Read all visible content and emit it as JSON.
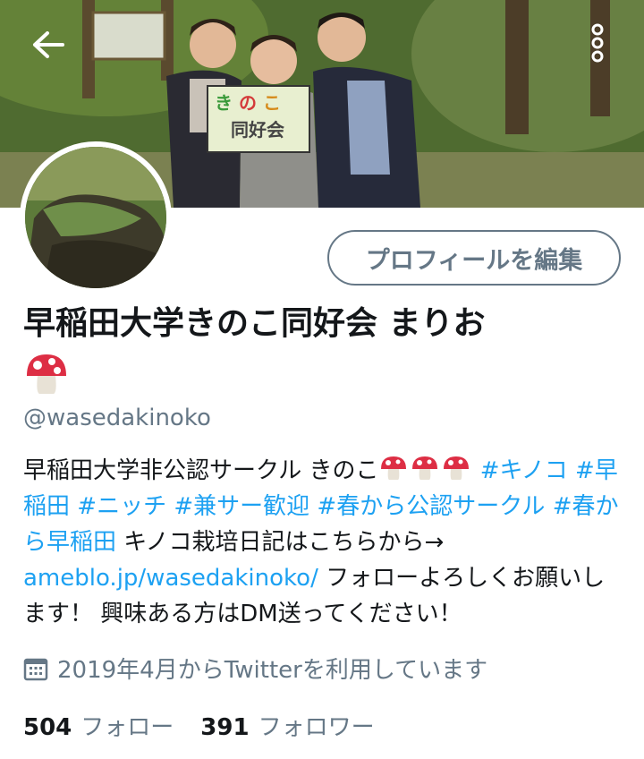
{
  "header": {
    "back_icon": "arrow-left-icon",
    "more_icon": "more-vertical-icon",
    "banner_sign_text": [
      "き",
      "の",
      "こ",
      "同好会"
    ]
  },
  "profile": {
    "edit_button": "プロフィールを編集",
    "name": "早稲田大学きのこ同好会 まりお",
    "name_emoji": "mushroom-icon",
    "handle": "@wasedakinoko"
  },
  "bio": {
    "text_1": "早稲田大学非公認サークル きのこ",
    "hashtags": [
      "#キノコ",
      "#早稲田",
      "#ニッチ",
      "#兼サー歓迎",
      "#春から公認サークル",
      "#春から早稲田"
    ],
    "text_2": "キノコ栽培日記はこちらから→",
    "link": "ameblo.jp/wasedakinoko/",
    "text_3": "フォローよろしくお願いします！ 興味ある方はDM送ってください！"
  },
  "joined": {
    "icon": "calendar-icon",
    "text": "2019年4月からTwitterを利用しています"
  },
  "stats": {
    "following_count": "504",
    "following_label": "フォロー",
    "followers_count": "391",
    "followers_label": "フォロワー"
  },
  "colors": {
    "accent": "#1da1f2",
    "secondary_text": "#657786",
    "primary_text": "#14171a"
  }
}
